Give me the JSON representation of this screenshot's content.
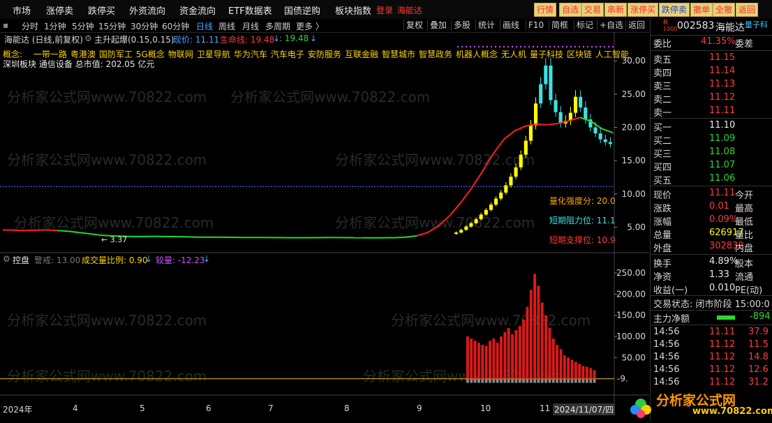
{
  "topbar": {
    "menus": [
      "市场",
      "涨停卖",
      "跌停买",
      "外资流向",
      "资金流向",
      "ETF数据表",
      "国债逆购",
      "板块指数"
    ],
    "login": "登录",
    "stock": "海能达",
    "buttons": [
      "行情",
      "自选",
      "交易",
      "串新",
      "涨停买",
      "跌停卖",
      "撤单",
      "全撤",
      "返回"
    ]
  },
  "periods": {
    "items": [
      "分时",
      "1分钟",
      "5分钟",
      "15分钟",
      "30分钟",
      "60分钟",
      "日线",
      "周线",
      "月线",
      "多周期",
      "更多 〉"
    ],
    "active": "日线"
  },
  "tools": [
    "复权",
    "叠加",
    "多股",
    "统计",
    "画线",
    "F10",
    "简框",
    "标记",
    "+自选",
    "返回"
  ],
  "chart_header": {
    "title": "海能达 (日线,前复权)",
    "indicator": "主升起爆(0.15,0.15)",
    "price_label": "现价: 11.11",
    "life_label": "生命线: 19.48",
    "extra_label": ": 19.48"
  },
  "concepts": {
    "prefix": "概念:",
    "items": [
      "一带一路",
      "粤港澳",
      "国防军工",
      "5G概念",
      "物联网",
      "卫星导航",
      "华为汽车",
      "汽车电子",
      "安防服务",
      "互联金融",
      "智慧城市",
      "智慧政务",
      "机器人概念",
      "无人机",
      "量子科技",
      "区块链",
      "人工智能"
    ],
    "sector": "深圳板块",
    "industry": "通信设备",
    "cap_label": "总市值:",
    "cap_value": "202.05 亿元"
  },
  "annotations": {
    "strength": "量化强度分: 20.0",
    "resist": "短期阻力位: 11.1",
    "support": "短期支撑位: 10.9",
    "low_mark": "3.37"
  },
  "lower_header": {
    "name": "控盘",
    "warn": "警戒: 13.00",
    "ratio": "成交量比例: 0.90",
    "compare": "较量: -12.23"
  },
  "watermark_text": "分析家公式网www.70822.com",
  "logo_text": "分析家公式网",
  "logo_url": "www.70822.com",
  "date_axis": {
    "labels": [
      "2024年",
      "4",
      "5",
      "6",
      "7",
      "8",
      "9",
      "10",
      "11"
    ],
    "cursor_date": "2024/11/07/四"
  },
  "chart_data": [
    {
      "type": "line",
      "title": "海能达 日线",
      "y_axis_ticks": [
        5.0,
        10.0,
        15.0,
        20.0,
        25.0,
        30.0
      ],
      "ylim": [
        1.8,
        31.6
      ],
      "reference_line": 11.11,
      "x_month_ticks": [
        "4",
        "5",
        "6",
        "7",
        "8",
        "9",
        "10",
        "11"
      ],
      "series": [
        {
          "name": "生命线",
          "values": [
            4.6,
            4.55,
            4.5,
            4.55,
            4.6,
            4.5,
            4.4,
            4.2,
            4.0,
            3.8,
            3.7,
            3.65,
            3.6,
            3.6,
            3.62,
            3.6,
            3.58,
            3.55,
            3.5,
            3.5,
            3.5,
            3.48,
            3.45,
            3.45,
            3.45,
            3.44,
            3.42,
            3.42,
            3.42,
            3.43,
            3.45,
            3.44,
            3.42,
            3.41,
            3.4,
            3.41,
            3.42,
            3.5,
            3.7,
            4.2,
            5.2,
            6.7,
            8.6,
            10.8,
            13.3,
            16.0,
            18.2,
            19.5,
            20.2,
            20.5,
            20.4,
            20.6,
            21.0,
            21.5,
            20.9,
            19.8,
            19.2
          ],
          "colors_up": "#ff2020",
          "colors_down": "#22dd22"
        }
      ],
      "candles": {
        "note": "candlesticks from Oct onward",
        "closes": [
          4.2,
          4.6,
          5.1,
          5.6,
          6.2,
          6.9,
          7.6,
          8.4,
          9.3,
          10.2,
          11.3,
          12.6,
          14.0,
          15.9,
          18.0,
          20.3,
          23.6,
          26.5,
          29.3,
          24.1,
          22.3,
          20.6,
          21.0,
          22.2,
          24.6,
          23.0,
          21.2,
          20.0,
          19.1,
          18.2,
          17.8,
          17.5
        ]
      }
    },
    {
      "type": "bar",
      "title": "控盘",
      "y_axis_ticks": [
        50.0,
        100.0,
        150.0,
        200.0,
        250.0
      ],
      "ylim": [
        -9,
        275
      ],
      "axis_label_left": "-9.",
      "values": [
        100,
        95,
        90,
        85,
        80,
        78,
        90,
        95,
        85,
        100,
        110,
        120,
        105,
        115,
        125,
        140,
        170,
        210,
        248,
        220,
        180,
        150,
        120,
        95,
        80,
        70,
        55,
        50,
        45,
        40,
        35,
        30,
        28,
        25,
        20
      ],
      "baseline_series": "警戒"
    }
  ],
  "right": {
    "code": "002583",
    "name": "海能达",
    "tag": "量子科",
    "weibi": {
      "k": "委比",
      "v": "41.35%",
      "v2": "委差"
    },
    "asks": [
      {
        "k": "卖五",
        "v": "11.15"
      },
      {
        "k": "卖四",
        "v": "11.14"
      },
      {
        "k": "卖三",
        "v": "11.13"
      },
      {
        "k": "卖二",
        "v": "11.12"
      },
      {
        "k": "卖一",
        "v": "11.11"
      }
    ],
    "bids": [
      {
        "k": "买一",
        "v": "11.10"
      },
      {
        "k": "买二",
        "v": "11.09"
      },
      {
        "k": "买三",
        "v": "11.08"
      },
      {
        "k": "买四",
        "v": "11.07"
      },
      {
        "k": "买五",
        "v": "11.06"
      }
    ],
    "stats": [
      {
        "k": "现价",
        "v": "11.11",
        "v2": "今开",
        "c": "red"
      },
      {
        "k": "涨跌",
        "v": "0.01",
        "v2": "最高",
        "c": "red"
      },
      {
        "k": "涨幅",
        "v": "0.09%",
        "v2": "最低",
        "c": "red"
      },
      {
        "k": "总量",
        "v": "626917",
        "v2": "量比",
        "c": "yellow"
      },
      {
        "k": "外盘",
        "v": "302832",
        "v2": "内盘",
        "c": "red"
      }
    ],
    "stats2": [
      {
        "k": "换手",
        "v": "4.89%",
        "v2": "股本",
        "c": "white"
      },
      {
        "k": "净资",
        "v": "1.33",
        "v2": "流通",
        "c": "white"
      },
      {
        "k": "收益(一)",
        "v": "0.010",
        "v2": "PE(动)",
        "c": "white"
      }
    ],
    "trade_state": "交易状态: 闭市阶段 15:00:0",
    "net_flow": {
      "k": "主力净额",
      "v": "-894"
    },
    "ticks": [
      {
        "t": "14:56",
        "p": "11.11",
        "q": "37.9"
      },
      {
        "t": "14:56",
        "p": "11.12",
        "q": "11.5"
      },
      {
        "t": "14:56",
        "p": "11.12",
        "q": "14.8"
      },
      {
        "t": "14:56",
        "p": "11.12",
        "q": "12.6"
      },
      {
        "t": "14:56",
        "p": "11.12",
        "q": "31.2"
      }
    ]
  },
  "colors": {
    "up": "#ff2020",
    "down": "#22dd22",
    "yellow": "#ffff00",
    "cyan": "#40e0e0",
    "bg": "#000000"
  }
}
